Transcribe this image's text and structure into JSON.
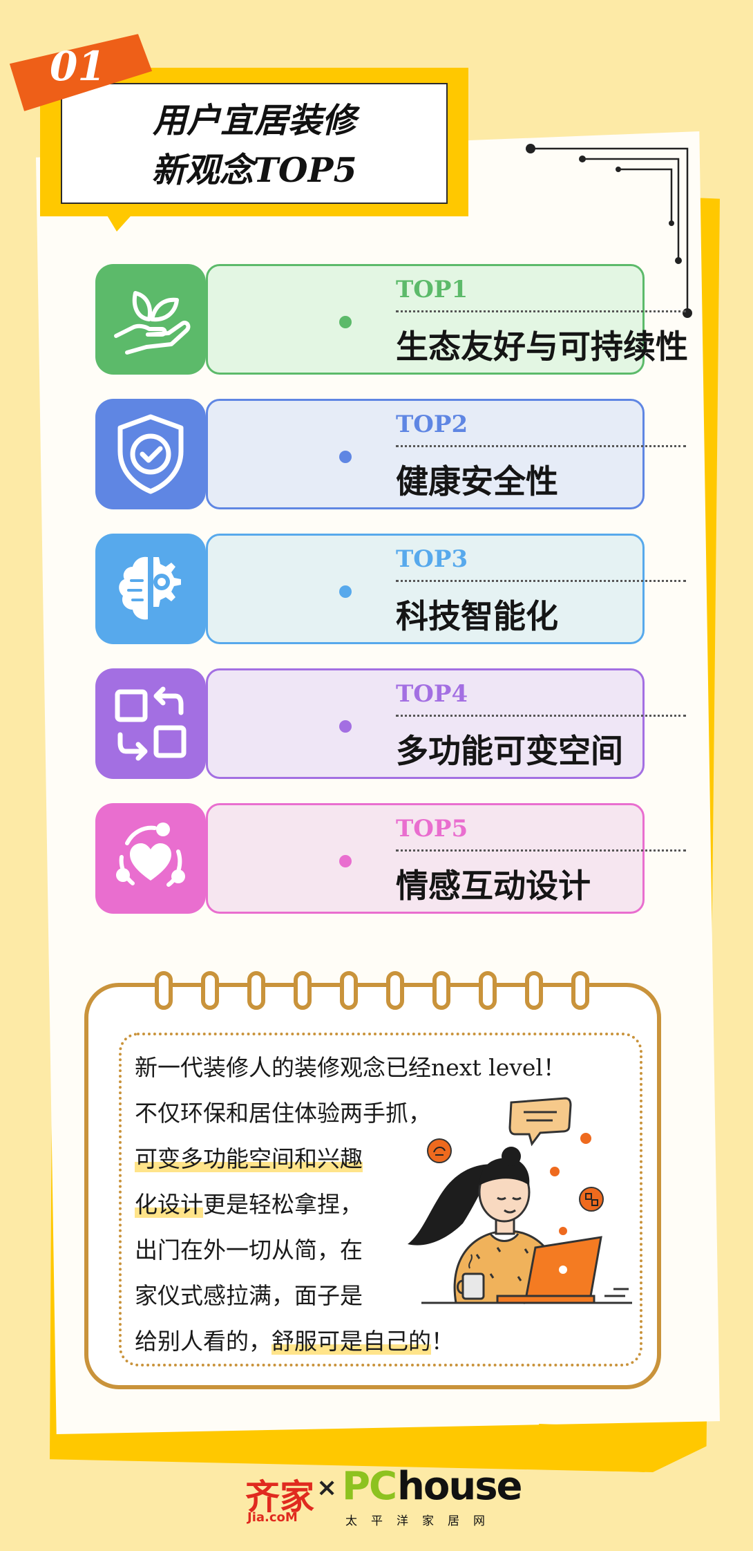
{
  "badge": {
    "number": "01"
  },
  "title": {
    "line1": "用户宜居装修",
    "line2": "新观念TOP5"
  },
  "items": [
    {
      "rank": "TOP1",
      "label": "生态友好与可持续性",
      "icon": "leaf-hand-icon",
      "color": "#5cba6a",
      "bg": "#e3f6e3",
      "rank_color": "#5cba6a"
    },
    {
      "rank": "TOP2",
      "label": "健康安全性",
      "icon": "shield-check-icon",
      "color": "#5f86e3",
      "bg": "#e6ecf7",
      "rank_color": "#5f86e3"
    },
    {
      "rank": "TOP3",
      "label": "科技智能化",
      "icon": "brain-gear-icon",
      "color": "#57a9ec",
      "bg": "#e5f2f3",
      "rank_color": "#57a9ec"
    },
    {
      "rank": "TOP4",
      "label": "多功能可变空间",
      "icon": "transform-space-icon",
      "color": "#a36fe2",
      "bg": "#efe6f6",
      "rank_color": "#a36fe2"
    },
    {
      "rank": "TOP5",
      "label": "情感互动设计",
      "icon": "heart-people-icon",
      "color": "#e96ecf",
      "bg": "#f6e6f0",
      "rank_color": "#e96ecf"
    }
  ],
  "note": {
    "line1": "新一代装修人的装修观念已经next level！",
    "line2": "不仅环保和居住体验两手抓，",
    "line3": "可变多功能空间和兴趣",
    "line4a": "化设计",
    "line4b": "更是轻松拿捏，",
    "line5": "出门在外一切从简，在",
    "line6": "家仪式感拉满，面子是",
    "line7a": "给别人看的，",
    "line7b": "舒服可是自己的",
    "line7c": "！"
  },
  "footer": {
    "brand1": "齐家",
    "brand1_sub": "Jia.coM",
    "separator": "×",
    "brand2_pc": "PC",
    "brand2_house": "house",
    "brand2_sub": "太平洋家居网"
  }
}
